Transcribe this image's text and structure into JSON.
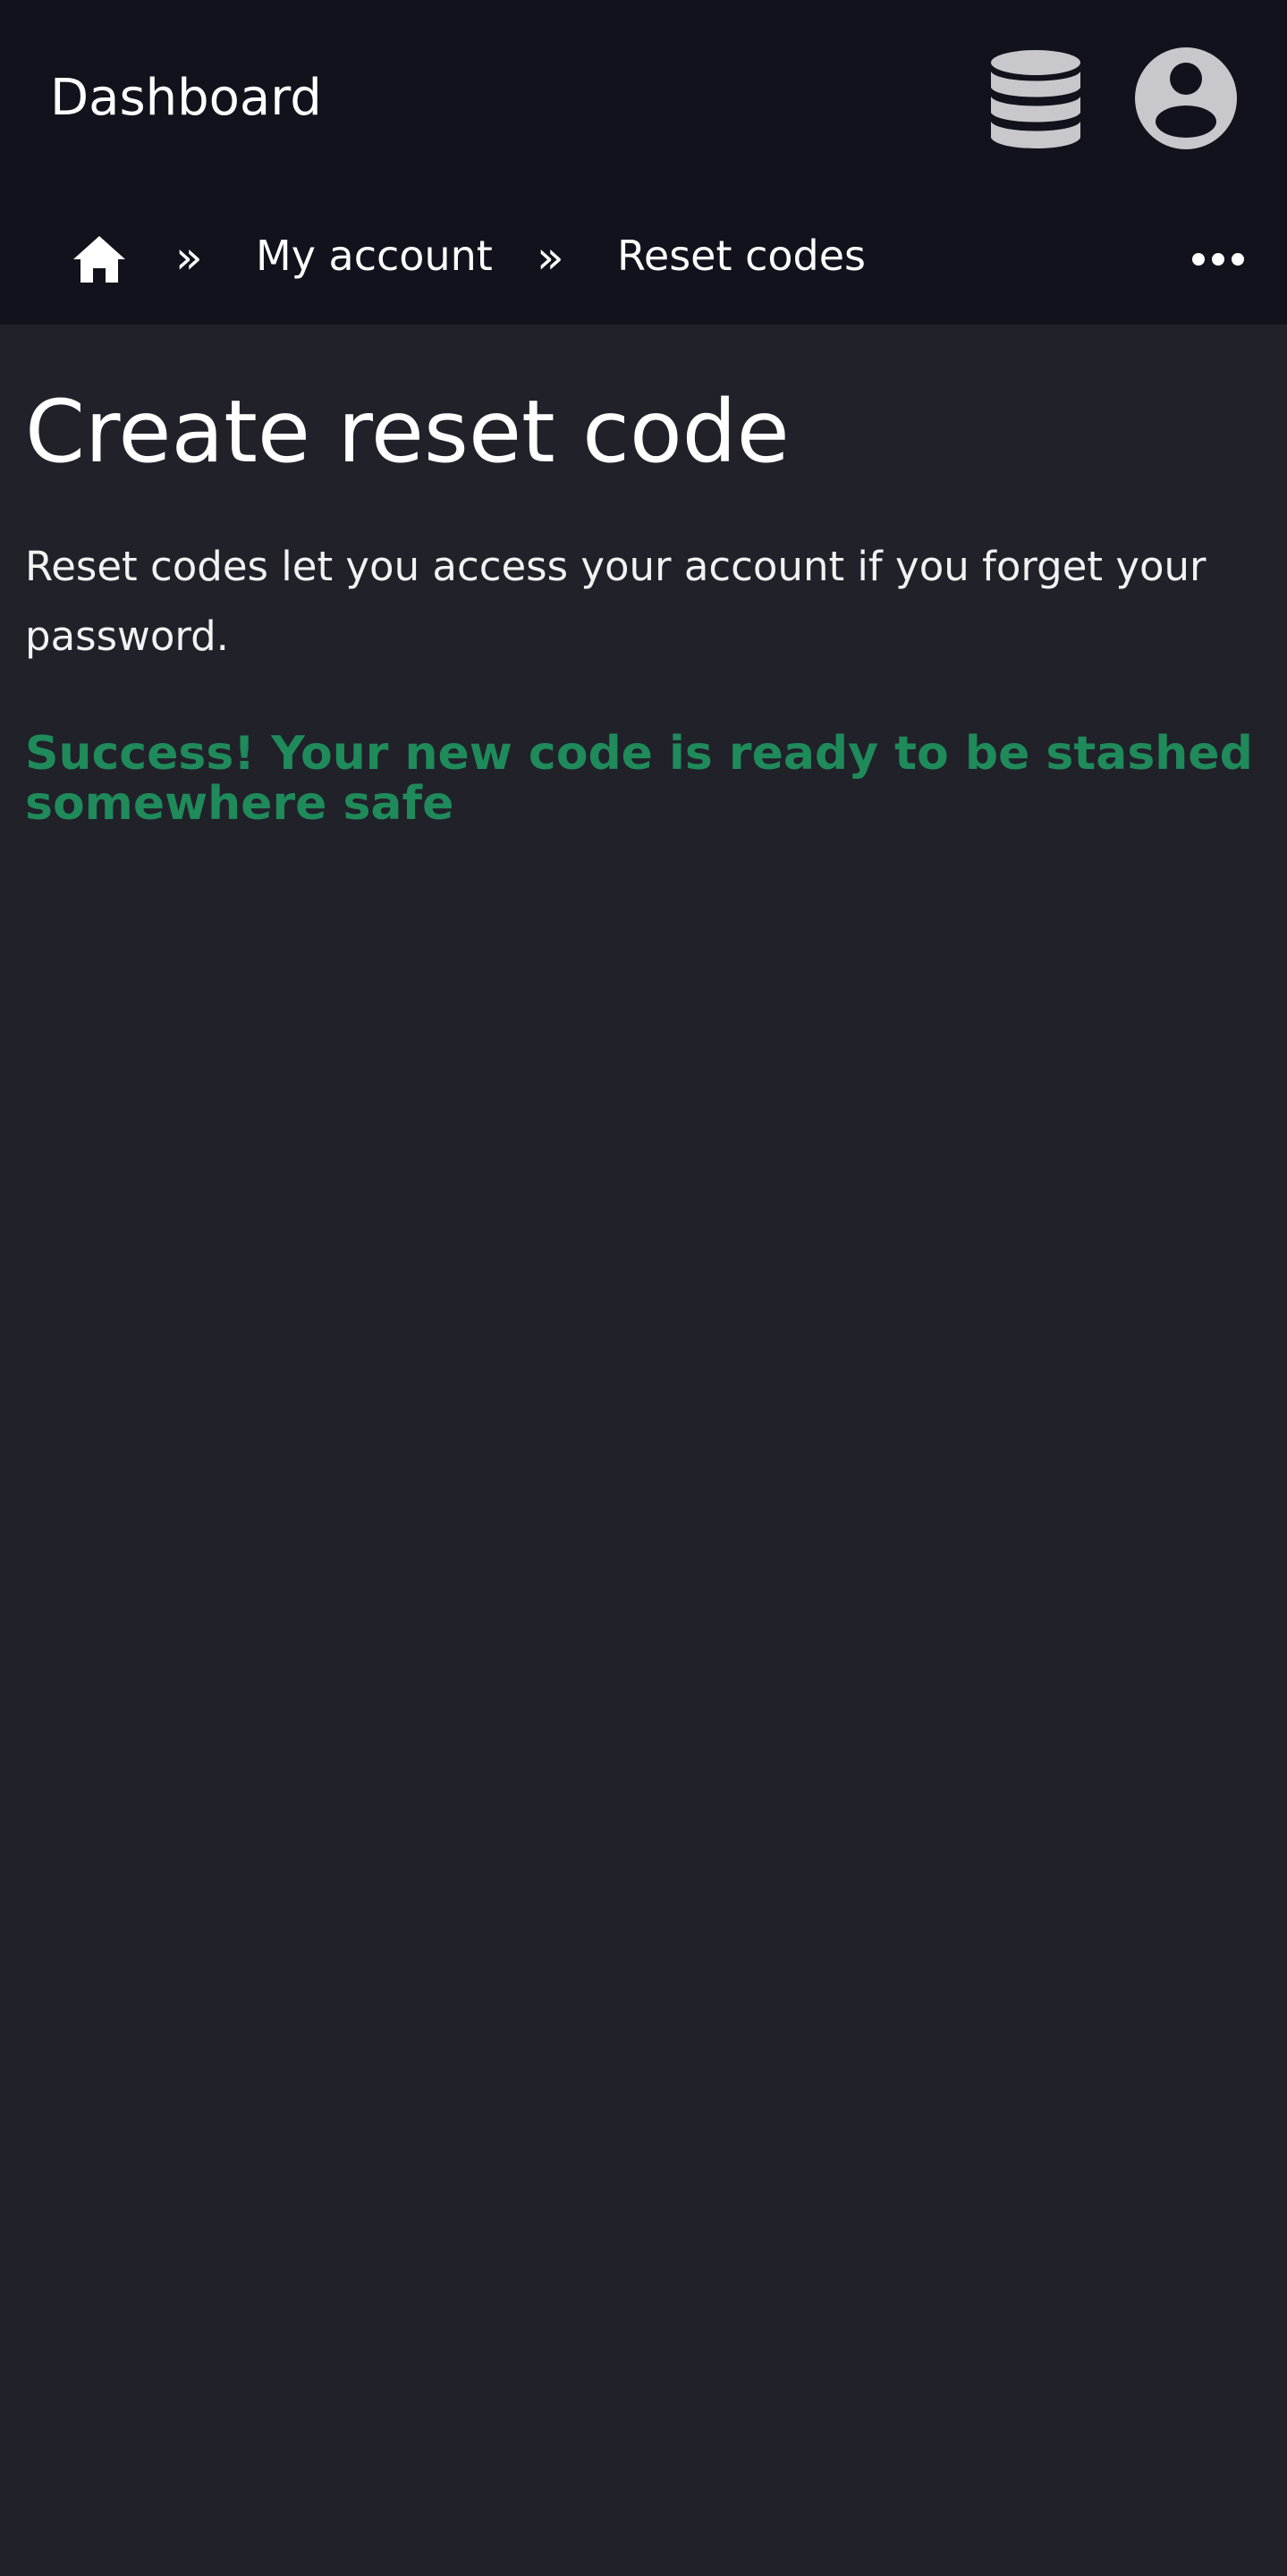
{
  "header": {
    "app_title": "Dashboard",
    "icons": {
      "database": "database-icon",
      "account": "user-circle-icon"
    }
  },
  "breadcrumb": {
    "home_icon": "home-icon",
    "separator": "»",
    "items": [
      {
        "label": "My account"
      },
      {
        "label": "Reset codes"
      }
    ],
    "more_icon": "ellipsis-icon"
  },
  "main": {
    "title": "Create reset code",
    "description": "Reset codes let you access your account if you forget your password.",
    "success_message": "Success! Your new code is ready to be stashed somewhere safe"
  },
  "colors": {
    "header_bg": "#12121c",
    "page_bg": "#21212a",
    "icon_gray": "#c8c8cc",
    "success_green": "#1f8a5a",
    "text": "#ffffff"
  }
}
